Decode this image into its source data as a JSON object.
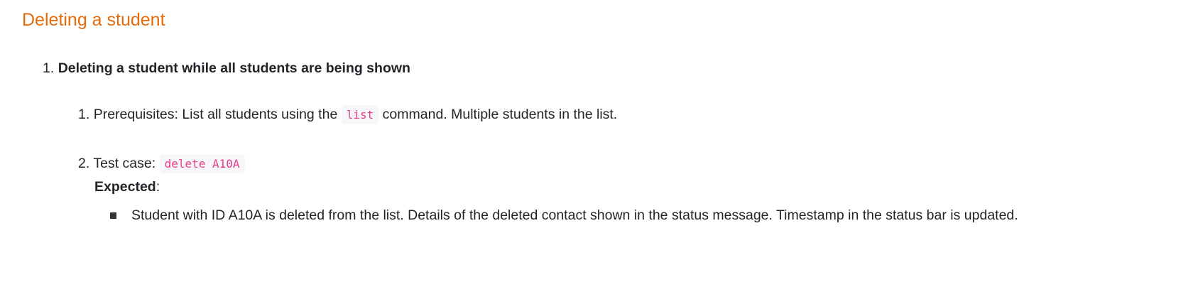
{
  "heading": "Deleting a student",
  "item1": {
    "number": "1.",
    "title": "Deleting a student while all students are being shown"
  },
  "sub1": {
    "number": "1.",
    "before": "Prerequisites: List all students using the",
    "code": "list",
    "after": "command. Multiple students in the list."
  },
  "sub2": {
    "number": "2.",
    "before": "Test case:",
    "code": "delete A10A",
    "expected_label": "Expected",
    "expected_colon": ":",
    "bullet": "Student with ID A10A is deleted from the list. Details of the deleted contact shown in the status message. Timestamp in the status bar is updated."
  },
  "colors": {
    "heading": "#e46c0a",
    "code": "#e83e8c"
  }
}
